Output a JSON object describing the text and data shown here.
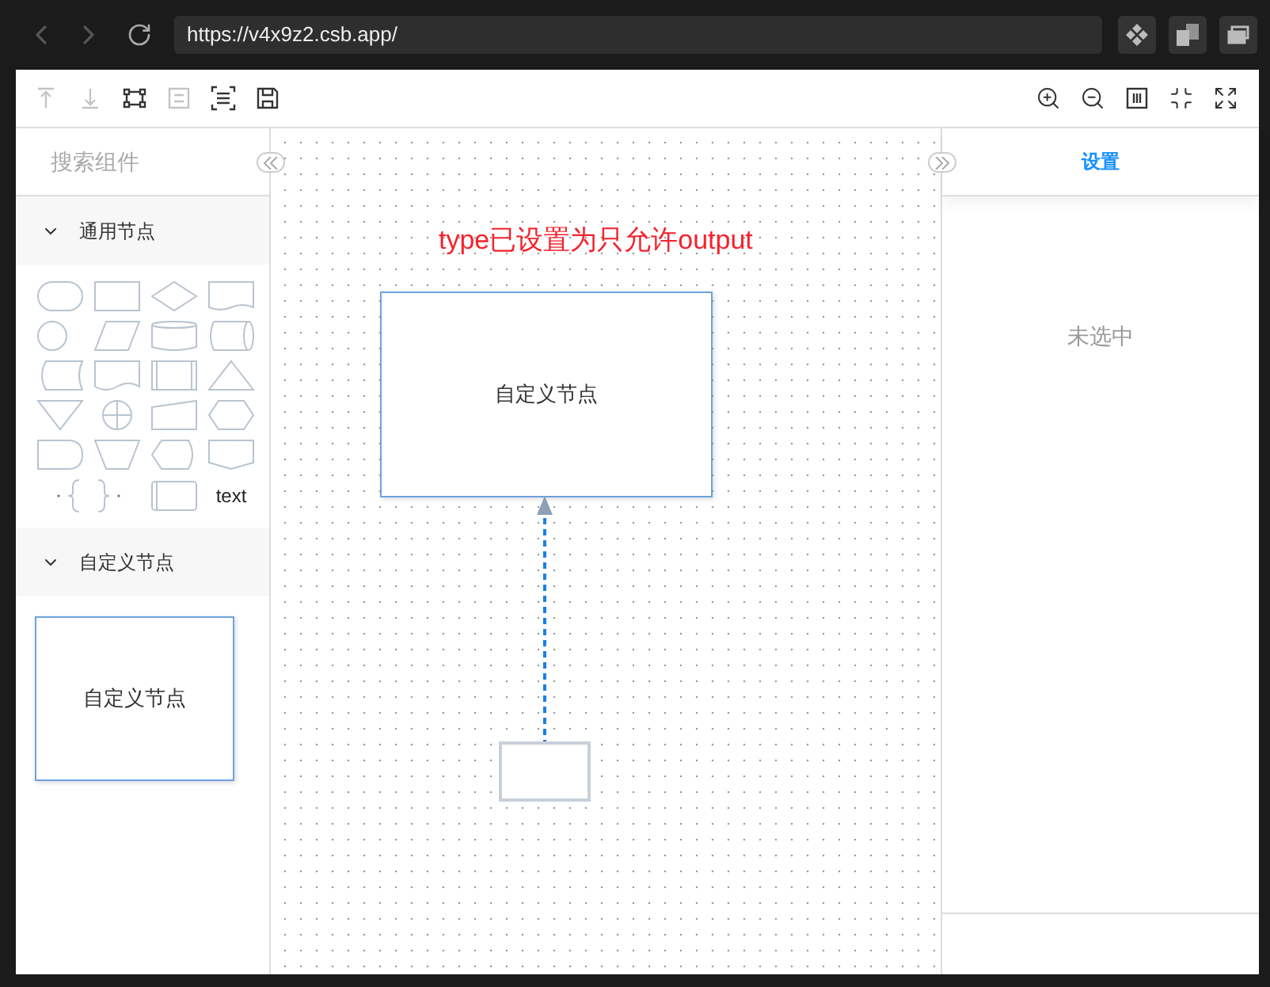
{
  "browser": {
    "url": "https://v4x9z2.csb.app/",
    "back_disabled": true,
    "forward_disabled": true
  },
  "toolbar": {
    "left": [
      {
        "kind": "top",
        "disabled": true
      },
      {
        "kind": "bottom",
        "disabled": true
      },
      {
        "kind": "select-area",
        "disabled": false
      },
      {
        "kind": "group",
        "disabled": true
      },
      {
        "kind": "fit",
        "disabled": false
      },
      {
        "kind": "save",
        "disabled": false
      }
    ],
    "right": [
      {
        "kind": "zoom-in",
        "disabled": false
      },
      {
        "kind": "zoom-out",
        "disabled": false
      },
      {
        "kind": "actual-size",
        "disabled": false
      },
      {
        "kind": "exit-fullscreen",
        "disabled": false
      },
      {
        "kind": "fullscreen",
        "disabled": false
      }
    ]
  },
  "sidebar": {
    "search": {
      "placeholder": "搜索组件"
    },
    "sections": [
      {
        "title": "通用节点",
        "expanded": true,
        "items": [
          {
            "kind": "terminator"
          },
          {
            "kind": "rect"
          },
          {
            "kind": "diamond"
          },
          {
            "kind": "document"
          },
          {
            "kind": "circle"
          },
          {
            "kind": "parallelogram"
          },
          {
            "kind": "cylinder"
          },
          {
            "kind": "drum"
          },
          {
            "kind": "stored-data"
          },
          {
            "kind": "tape"
          },
          {
            "kind": "predefined"
          },
          {
            "kind": "triangle"
          },
          {
            "kind": "merge"
          },
          {
            "kind": "junction"
          },
          {
            "kind": "manual-input"
          },
          {
            "kind": "hexagon"
          },
          {
            "kind": "delay"
          },
          {
            "kind": "manual-op"
          },
          {
            "kind": "display"
          },
          {
            "kind": "offpage"
          },
          {
            "kind": "brace"
          },
          {
            "kind": "internal"
          },
          {
            "kind": "text",
            "label": "text"
          }
        ]
      },
      {
        "title": "自定义节点",
        "expanded": true,
        "items": [
          {
            "kind": "custom",
            "label": "自定义节点"
          }
        ]
      }
    ]
  },
  "canvas": {
    "note": "type已设置为只允许output",
    "nodes": [
      {
        "kind": "custom",
        "label": "自定义节点"
      },
      {
        "kind": "rect"
      }
    ]
  },
  "settings": {
    "tab": "设置",
    "empty": "未选中"
  }
}
